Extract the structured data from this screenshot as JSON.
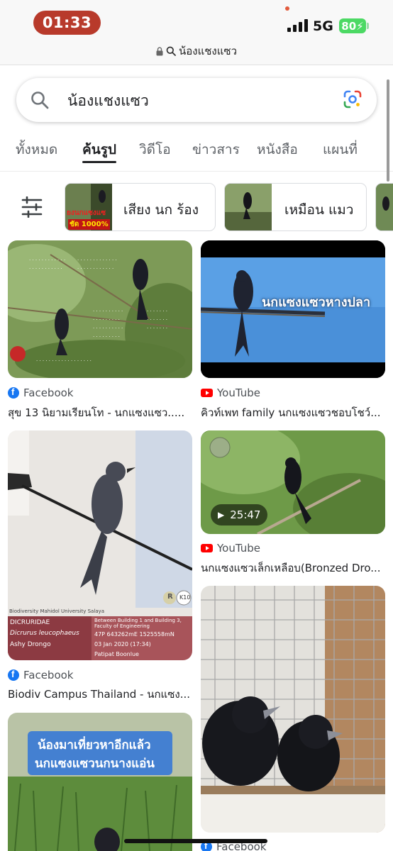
{
  "status_bar": {
    "time": "01:33",
    "network": "5G",
    "battery": "80",
    "url": "น้องแชงแซว"
  },
  "search": {
    "query": "น้องแชงแซว"
  },
  "tabs": [
    "ทั้งหมด",
    "ค้นรูป",
    "วิดีโอ",
    "ข่าวสาร",
    "หนังสือ",
    "แผนที่"
  ],
  "chips": [
    {
      "label": "เสียง นก ร้อง",
      "thumb_text": "ยงนกแซงแซ",
      "thumb_badge": "ชัด 1000%"
    },
    {
      "label": "เหมือน แมว"
    }
  ],
  "results": [
    {
      "source": "Facebook",
      "title": "สุข 13 นิยามเรียนโท - นกแซงแซว.....",
      "image_text": []
    },
    {
      "source": "YouTube",
      "title": "คิวท์เพท family นกแซงแซวชอบโชว์...",
      "image_text": [
        "นกแซงแซวหางปลา"
      ]
    },
    {
      "source": "Facebook",
      "title": "Biodiv Campus Thailand - นกแซง...",
      "image_text": [
        "Biodiversity Mahidol University Salaya",
        "DICRURIDAE",
        "Dicrurus leucophaeus",
        "Ashy Drongo",
        "Between Building 1 and Building 3, Faculty of Engineering",
        "47P 643262mE 1525558mN",
        "03 Jan 2020 (17:34)",
        "Patipat Boonlue",
        "R",
        "K10"
      ]
    },
    {
      "source": "YouTube",
      "title": "นกแซงแซวเล็กเหลือบ(Bronzed Dro...",
      "duration": "25:47"
    },
    {
      "source": "",
      "title": "",
      "image_text": [
        "น้องมาเที่ยวหาอีกแล้ว",
        "นกแซงแซวนกนางแอ่น"
      ]
    },
    {
      "source": "Facebook",
      "title": ""
    }
  ],
  "colors": {
    "time_pill": "#b83a2b",
    "battery": "#4cd964",
    "facebook": "#1877f2",
    "youtube": "#ff0000"
  }
}
